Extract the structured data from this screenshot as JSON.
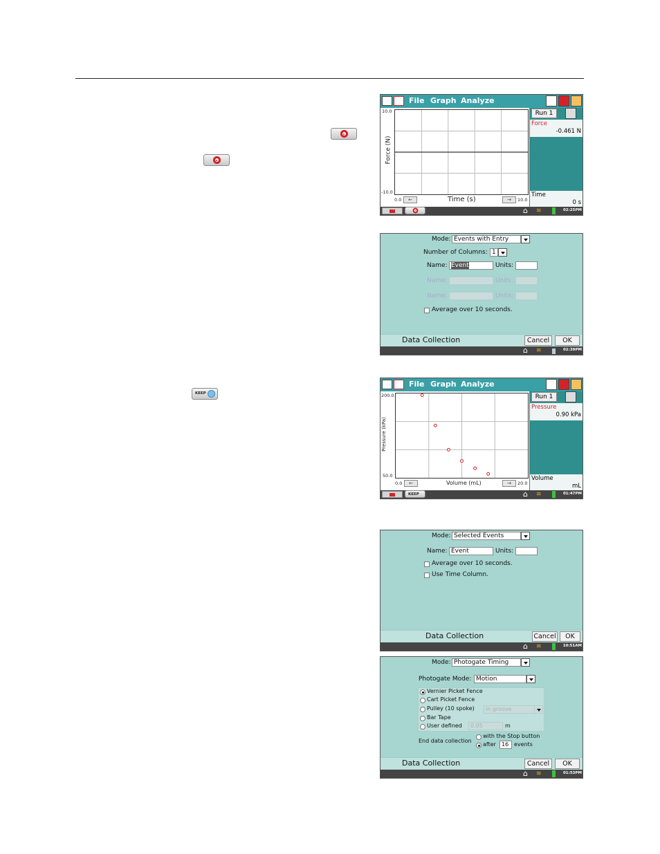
{
  "menu": {
    "file": "File",
    "graph": "Graph",
    "analyze": "Analyze"
  },
  "inline_buttons": {
    "keep": "KEEP"
  },
  "screen1": {
    "run": "Run 1",
    "ymax": "10.0",
    "ymin": "-10.0",
    "ylabel": "Force (N)",
    "xmin": "0.0",
    "xmax": "10.0",
    "xlabel": "Time (s)",
    "meter1_label": "Force",
    "meter1_value": "-0.461 N",
    "meter2_label": "Time",
    "meter2_value": "0 s",
    "clock": "02:25PM",
    "trace_color": "#333333"
  },
  "screen2": {
    "mode_label": "Mode:",
    "mode_value": "Events with Entry",
    "cols_label": "Number of Columns:",
    "cols_value": "1",
    "name_label": "Name:",
    "name_value": "Event",
    "units_label": "Units:",
    "units_value": "",
    "name2_label": "Name:",
    "units2_label": "Units:",
    "name3_label": "Name:",
    "units3_label": "Units:",
    "avg_label": "Average over 10 seconds.",
    "footer": "Data Collection",
    "cancel": "Cancel",
    "ok": "OK",
    "clock": "02:39PM"
  },
  "screen3": {
    "run": "Run 1",
    "ymax": "200.0",
    "ymin": "50.0",
    "ylabel": "Pressure (kPa)",
    "xmin": "0.0",
    "xmax": "20.0",
    "xlabel": "Volume (mL)",
    "meter1_label": "Pressure",
    "meter1_value": "0.90 kPa",
    "meter2_label": "Volume",
    "meter2_value": "mL",
    "clock": "01:47PM",
    "point_color": "#d2232a"
  },
  "chart_data": [
    {
      "type": "line",
      "title": "",
      "xlabel": "Time (s)",
      "ylabel": "Force (N)",
      "xlim": [
        0,
        10
      ],
      "ylim": [
        -10,
        10
      ],
      "series": [
        {
          "x": [
            0,
            10
          ],
          "y": [
            0,
            0
          ]
        }
      ],
      "grid": true
    },
    {
      "type": "scatter",
      "title": "",
      "xlabel": "Volume (mL)",
      "ylabel": "Pressure (kPa)",
      "xlim": [
        0,
        20
      ],
      "ylim": [
        50,
        200
      ],
      "series": [
        {
          "x": [
            4,
            6,
            8,
            10,
            12,
            14
          ],
          "y": [
            200,
            143,
            100,
            80,
            67,
            57
          ]
        }
      ],
      "grid": true
    }
  ],
  "screen4": {
    "mode_label": "Mode:",
    "mode_value": "Selected Events",
    "name_label": "Name:",
    "name_value": "Event",
    "units_label": "Units:",
    "units_value": "",
    "avg_label": "Average over 10 seconds.",
    "time_label": "Use Time Column.",
    "footer": "Data Collection",
    "cancel": "Cancel",
    "ok": "OK",
    "clock": "10:51AM"
  },
  "screen5": {
    "mode_label": "Mode:",
    "mode_value": "Photogate Timing",
    "pg_label": "Photogate Mode:",
    "pg_value": "Motion",
    "opt1": "Vernier Picket Fence",
    "opt2": "Cart Picket Fence",
    "opt3": "Pulley (10 spoke)",
    "opt3_select": "in groove",
    "opt4": "Bar Tape",
    "opt5": "User defined",
    "opt5_value": "0.05",
    "opt5_unit": "m",
    "end_label": "End data collection",
    "end_opt1": "with the Stop button",
    "end_opt2_a": "after",
    "end_opt2_value": "16",
    "end_opt2_b": "events",
    "footer": "Data Collection",
    "cancel": "Cancel",
    "ok": "OK",
    "clock": "01:53PM"
  }
}
